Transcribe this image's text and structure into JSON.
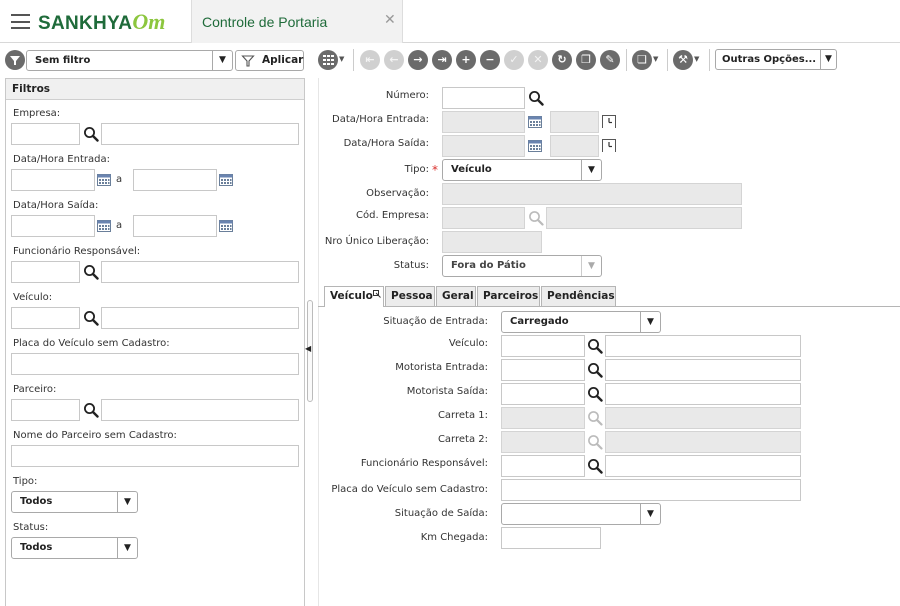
{
  "header": {
    "brand": "SANKHYA",
    "brand_suffix": "Om",
    "tab_title": "Controle de Portaria"
  },
  "filter_bar": {
    "filter_select": "Sem filtro",
    "apply_label": "Aplicar"
  },
  "filters": {
    "title": "Filtros",
    "empresa": "Empresa:",
    "data_entrada": "Data/Hora Entrada:",
    "data_saida": "Data/Hora Saída:",
    "ate": "a",
    "funcionario": "Funcionário Responsável:",
    "veiculo": "Veículo:",
    "placa": "Placa do Veículo sem Cadastro:",
    "parceiro": "Parceiro:",
    "nome_parceiro": "Nome do Parceiro sem Cadastro:",
    "tipo": "Tipo:",
    "tipo_value": "Todos",
    "status": "Status:",
    "status_value": "Todos"
  },
  "toolbar": {
    "more_options": "Outras Opções..."
  },
  "form": {
    "numero": "Número:",
    "data_entrada": "Data/Hora Entrada:",
    "data_saida": "Data/Hora Saída:",
    "tipo": "Tipo:",
    "tipo_value": "Veículo",
    "observacao": "Observação:",
    "cod_empresa": "Cód. Empresa:",
    "nro_liberacao": "Nro Único Liberação:",
    "status": "Status:",
    "status_value": "Fora do Pátio"
  },
  "tabs": [
    "Veículo",
    "Pessoa",
    "Geral",
    "Parceiros",
    "Pendências"
  ],
  "vehicle_tab": {
    "situacao_entrada": "Situação de Entrada:",
    "situacao_entrada_value": "Carregado",
    "veiculo": "Veículo:",
    "motorista_entrada": "Motorista Entrada:",
    "motorista_saida": "Motorista Saída:",
    "carreta1": "Carreta 1:",
    "carreta2": "Carreta 2:",
    "funcionario": "Funcionário Responsável:",
    "placa": "Placa do Veículo sem Cadastro:",
    "situacao_saida": "Situação de Saída:",
    "situacao_saida_value": "",
    "km_chegada": "Km Chegada:"
  }
}
